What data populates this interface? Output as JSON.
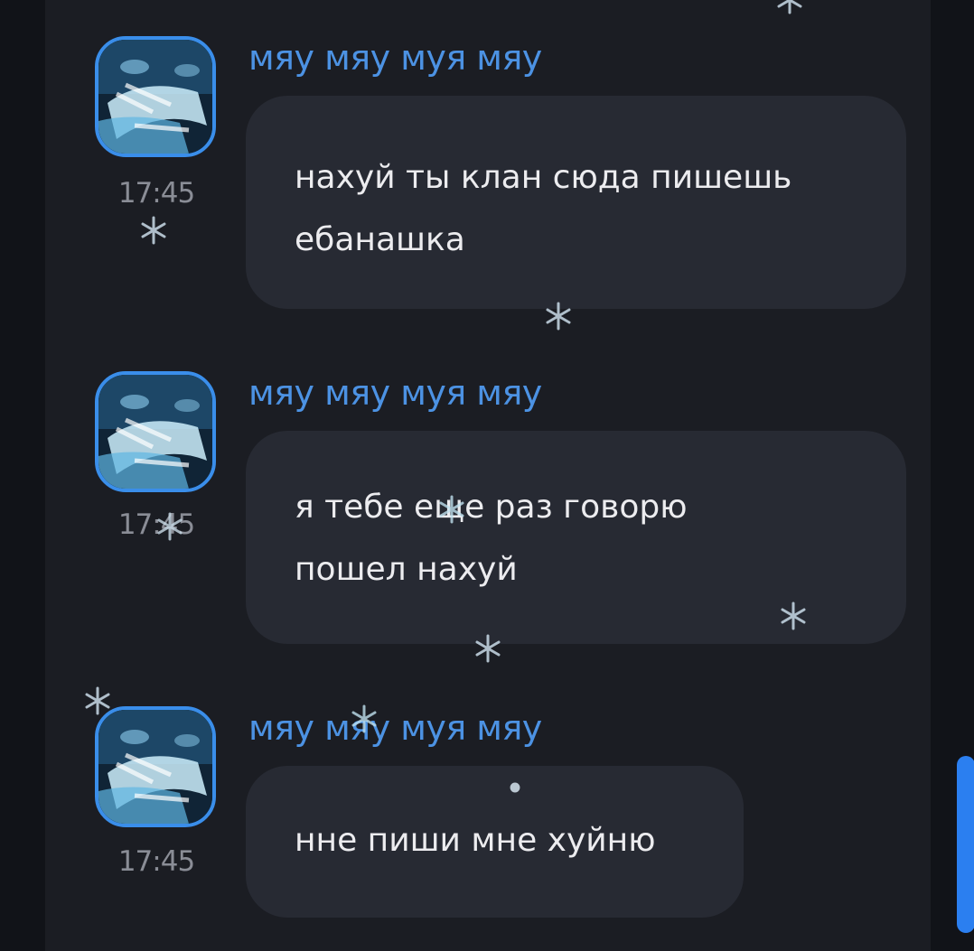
{
  "messages": [
    {
      "sender": "мяу мяу муя мяу",
      "time": "17:45",
      "lines": [
        "нахуй ты клан сюда пишешь",
        "ебанашка"
      ]
    },
    {
      "sender": "мяу мяу муя мяу",
      "time": "17:45",
      "lines": [
        "я тебе еще раз говорю",
        "пошел нахуй"
      ]
    },
    {
      "sender": "мяу мяу муя мяу",
      "time": "17:45",
      "lines": [
        "нне пиши мне хуйню"
      ]
    }
  ],
  "icons": {
    "avatar": "user-avatar-photo",
    "snowflake": "snowflake-icon"
  },
  "colors": {
    "background": "#1b1d23",
    "bubble": "#272a33",
    "sender_name": "#4c92e3",
    "avatar_border": "#3a8eea",
    "scrollbar": "#2b7ff0",
    "message_text": "#ececef",
    "time_text": "#8a8d96"
  }
}
